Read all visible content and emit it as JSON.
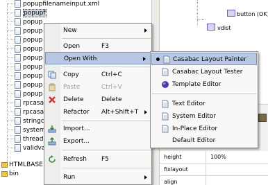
{
  "tree": {
    "items": [
      {
        "label": "popupfilenameinput.xml",
        "type": "file"
      },
      {
        "label": "popupf",
        "type": "file",
        "selected": true
      },
      {
        "label": "popup",
        "type": "file"
      },
      {
        "label": "popup",
        "type": "file"
      },
      {
        "label": "popup",
        "type": "file"
      },
      {
        "label": "popup",
        "type": "file"
      },
      {
        "label": "popup",
        "type": "file"
      },
      {
        "label": "popup",
        "type": "file"
      },
      {
        "label": "popup",
        "type": "file"
      },
      {
        "label": "popup",
        "type": "file"
      },
      {
        "label": "popup",
        "type": "file"
      },
      {
        "label": "rpcasa",
        "type": "file"
      },
      {
        "label": "rpcasa",
        "type": "file"
      },
      {
        "label": "stringc",
        "type": "file"
      },
      {
        "label": "system",
        "type": "file"
      },
      {
        "label": "thread",
        "type": "file"
      },
      {
        "label": "validva",
        "type": "file"
      },
      {
        "label": "HTMLBASE",
        "type": "folder"
      },
      {
        "label": "bin",
        "type": "folder"
      }
    ]
  },
  "context_menu": {
    "items": [
      {
        "label": "New",
        "shortcut": "",
        "submenu": true
      },
      {
        "label": "Open",
        "shortcut": "F3"
      },
      {
        "label": "Open With",
        "shortcut": "",
        "submenu": true,
        "highlighted": true
      },
      {
        "label": "Copy",
        "shortcut": "Ctrl+C",
        "icon": "copy-icon"
      },
      {
        "label": "Paste",
        "shortcut": "Ctrl+V",
        "icon": "paste-icon",
        "disabled": true
      },
      {
        "label": "Delete",
        "shortcut": "Delete",
        "icon": "delete-icon"
      },
      {
        "label": "Refactor",
        "shortcut": "Alt+Shift+T",
        "submenu": true
      },
      {
        "label": "Import...",
        "icon": "import-icon"
      },
      {
        "label": "Export...",
        "icon": "export-icon"
      },
      {
        "label": "Refresh",
        "shortcut": "F5",
        "icon": "refresh-icon"
      },
      {
        "label": "Run",
        "submenu": true
      }
    ]
  },
  "open_with_menu": {
    "items": [
      {
        "label": "Casabac Layout Painter",
        "checked": true
      },
      {
        "label": "Casabac Layout Tester"
      },
      {
        "label": "Template Editor",
        "icon": "template-icon"
      },
      {
        "label": "Text Editor"
      },
      {
        "label": "System Editor"
      },
      {
        "label": "In-Place Editor"
      },
      {
        "label": "Default Editor"
      }
    ]
  },
  "outline": {
    "nodes": [
      {
        "label": "button (OK)"
      },
      {
        "label": "vdist"
      }
    ]
  },
  "properties": {
    "rows": [
      {
        "key": "height",
        "value": "100%"
      },
      {
        "key": "fixlayout",
        "value": ""
      },
      {
        "key": "align",
        "value": ""
      }
    ]
  }
}
